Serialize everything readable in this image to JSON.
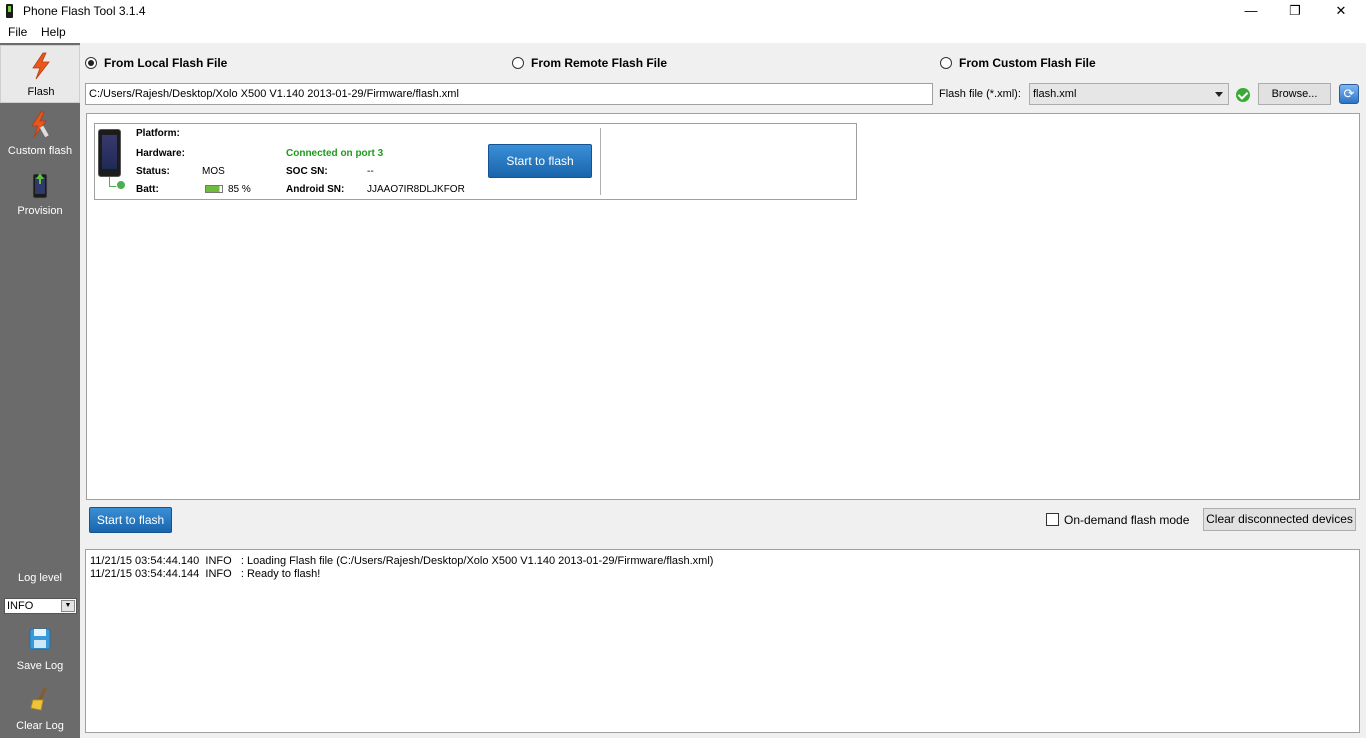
{
  "window": {
    "title": "Phone Flash Tool 3.1.4",
    "controls": [
      "—",
      "❐",
      "✕"
    ]
  },
  "menu": {
    "items": [
      "File",
      "Help"
    ]
  },
  "sidebar": {
    "items": [
      {
        "label": "Flash",
        "icon": "flash-icon",
        "active": true
      },
      {
        "label": "Custom flash",
        "icon": "custom-flash-icon",
        "active": false
      },
      {
        "label": "Provision",
        "icon": "provision-icon",
        "active": false
      }
    ],
    "log_level_label": "Log level",
    "log_level_value": "INFO",
    "save_log_label": "Save Log",
    "clear_log_label": "Clear Log"
  },
  "source": {
    "options": [
      {
        "label": "From Local Flash File",
        "checked": true
      },
      {
        "label": "From Remote Flash File",
        "checked": false
      },
      {
        "label": "From Custom Flash File",
        "checked": false
      }
    ],
    "path": "C:/Users/Rajesh/Desktop/Xolo X500 V1.140 2013-01-29/Firmware/flash.xml",
    "flash_file_label": "Flash file (*.xml):",
    "flash_file_value": "flash.xml",
    "browse_label": "Browse..."
  },
  "device": {
    "platform_key": "Platform:",
    "platform_value": "",
    "hardware_key": "Hardware:",
    "hardware_value": "",
    "connection": "Connected on port 3",
    "status_key": "Status:",
    "status_value": "MOS",
    "soc_key": "SOC SN:",
    "soc_value": "--",
    "batt_key": "Batt:",
    "batt_value": "85 %",
    "battery_level": 0.85,
    "android_key": "Android SN:",
    "android_value": "JJAAO7IR8DLJKFOR",
    "flash_button": "Start to flash"
  },
  "controls": {
    "start_flash": "Start to flash",
    "on_demand_label": "On-demand flash mode",
    "on_demand_checked": false,
    "clear_devices": "Clear disconnected devices"
  },
  "log": {
    "lines": [
      "11/21/15 03:54:44.140  INFO   : Loading Flash file (C:/Users/Rajesh/Desktop/Xolo X500 V1.140 2013-01-29/Firmware/flash.xml)",
      "11/21/15 03:54:44.144  INFO   : Ready to flash!"
    ]
  },
  "colors": {
    "sidebar_bg": "#6b6b6b",
    "accent_blue": "#1a65ac",
    "connected_green": "#1f9a1f"
  }
}
